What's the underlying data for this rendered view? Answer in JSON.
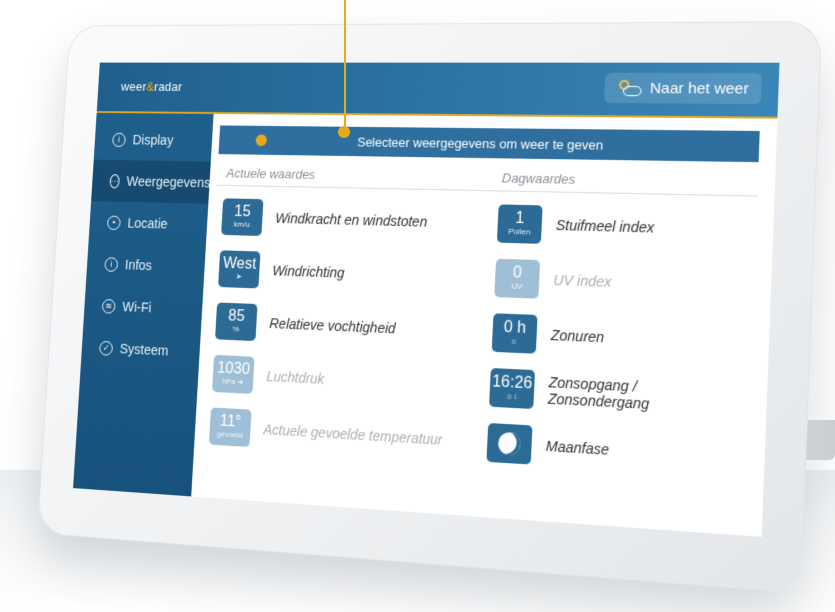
{
  "app": {
    "logo_text_left": "weer",
    "logo_amp": "&",
    "logo_text_right": "radar",
    "go_weather_label": "Naar het weer"
  },
  "sidebar": {
    "items": [
      {
        "label": "Display",
        "icon": "info-icon"
      },
      {
        "label": "Weergegevens",
        "icon": "dots-icon"
      },
      {
        "label": "Locatie",
        "icon": "location-icon"
      },
      {
        "label": "Infos",
        "icon": "info-icon"
      },
      {
        "label": "Wi-Fi",
        "icon": "wifi-icon"
      },
      {
        "label": "Systeem",
        "icon": "check-icon"
      }
    ],
    "active_index": 1
  },
  "main": {
    "select_bar_text": "Selecteer weergegevens om weer te geven",
    "col_current": "Actuele waardes",
    "col_daily": "Dagwaardes",
    "current_rows": [
      {
        "value": "15",
        "sub": "km/u",
        "label": "Windkracht en windstoten",
        "enabled": true
      },
      {
        "value": "West",
        "sub": "➤",
        "label": "Windrichting",
        "enabled": true
      },
      {
        "value": "85",
        "sub": "%",
        "label": "Relatieve vochtigheid",
        "enabled": true
      },
      {
        "value": "1030",
        "sub": "hPa ➜",
        "label": "Luchtdruk",
        "enabled": false
      },
      {
        "value": "11°",
        "sub": "gevoeld",
        "label": "Actuele gevoelde temperatuur",
        "enabled": false
      }
    ],
    "daily_rows": [
      {
        "value": "1",
        "sub": "Pollen",
        "label": "Stuifmeel index",
        "enabled": true
      },
      {
        "value": "0",
        "sub": "UV",
        "label": "UV index",
        "enabled": false
      },
      {
        "value": "0 h",
        "sub": "☼",
        "label": "Zonuren",
        "enabled": true
      },
      {
        "value": "16:26",
        "sub": "☼↓",
        "label": "Zonsopgang / Zonsondergang",
        "enabled": true
      },
      {
        "value": "",
        "sub": "",
        "label": "Maanfase",
        "enabled": true
      }
    ]
  },
  "colors": {
    "primary": "#2d6b97",
    "sidebar": "#1f5f8c",
    "accent": "#e9a91c",
    "disabled_tile": "#9fbfd6"
  }
}
